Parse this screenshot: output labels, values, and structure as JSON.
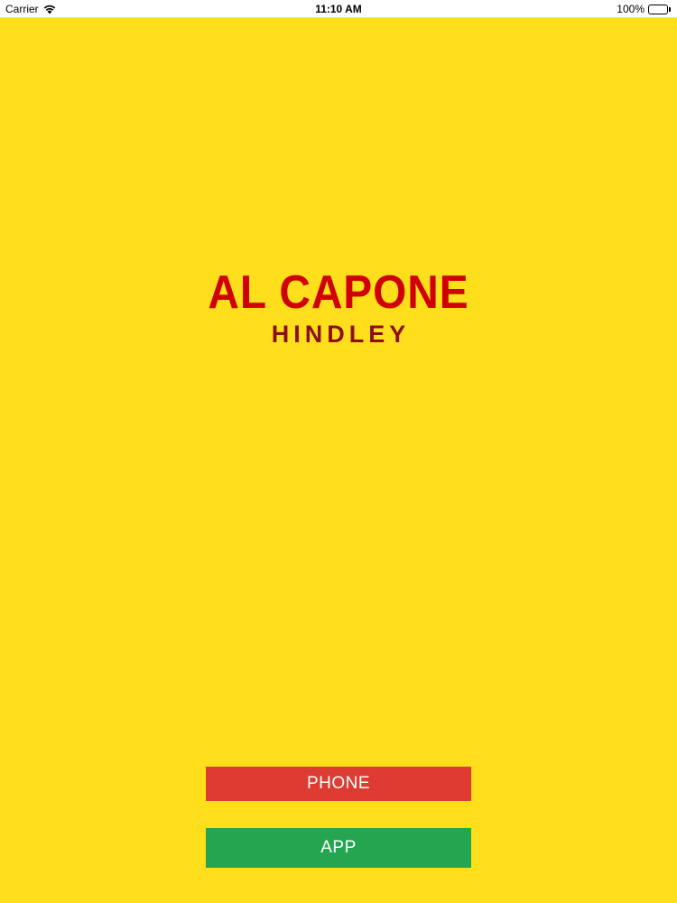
{
  "status_bar": {
    "carrier": "Carrier",
    "time": "11:10 AM",
    "battery": "100%",
    "battery_level": 1.0,
    "icons": [
      "wifi-icon",
      "battery-icon"
    ]
  },
  "logo": {
    "title": "AL CAPONE",
    "subtitle": "HINDLEY"
  },
  "buttons": {
    "phone_label": "PHONE",
    "app_label": "APP"
  },
  "colors": {
    "background": "#FFDF1B",
    "title_red": "#D00000",
    "subtitle_dark_red": "#8B0F0F",
    "phone_button": "#DE3B33",
    "app_button": "#24A650"
  }
}
